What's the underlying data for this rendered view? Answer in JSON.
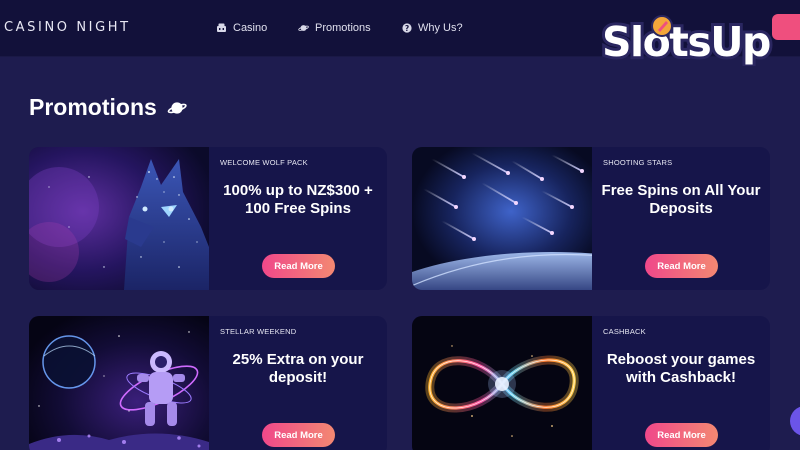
{
  "header": {
    "brand": "CASINO NIGHT",
    "nav": [
      {
        "label": "Casino",
        "icon": "casino-icon"
      },
      {
        "label": "Promotions",
        "icon": "planet-icon"
      },
      {
        "label": "Why Us?",
        "icon": "question-icon"
      }
    ]
  },
  "watermark": {
    "text": "SlotsUp"
  },
  "page": {
    "title": "Promotions",
    "title_icon": "planet-icon"
  },
  "promotions": [
    {
      "tag": "WELCOME WOLF PACK",
      "headline": "100% up to NZ$300 + 100 Free Spins",
      "button": "Read More",
      "image": "wolf"
    },
    {
      "tag": "SHOOTING STARS",
      "headline": "Free Spins on All Your Deposits",
      "button": "Read More",
      "image": "meteors"
    },
    {
      "tag": "STELLAR WEEKEND",
      "headline": "25% Extra on your deposit!",
      "button": "Read More",
      "image": "astronaut"
    },
    {
      "tag": "CASHBACK",
      "headline": "Reboost your games with Cashback!",
      "button": "Read More",
      "image": "infinity"
    }
  ],
  "colors": {
    "background": "#1e1c4f",
    "header": "#12113a",
    "card": "#16154a",
    "accent_pink": "#f0488a",
    "accent_orange": "#f38872"
  }
}
